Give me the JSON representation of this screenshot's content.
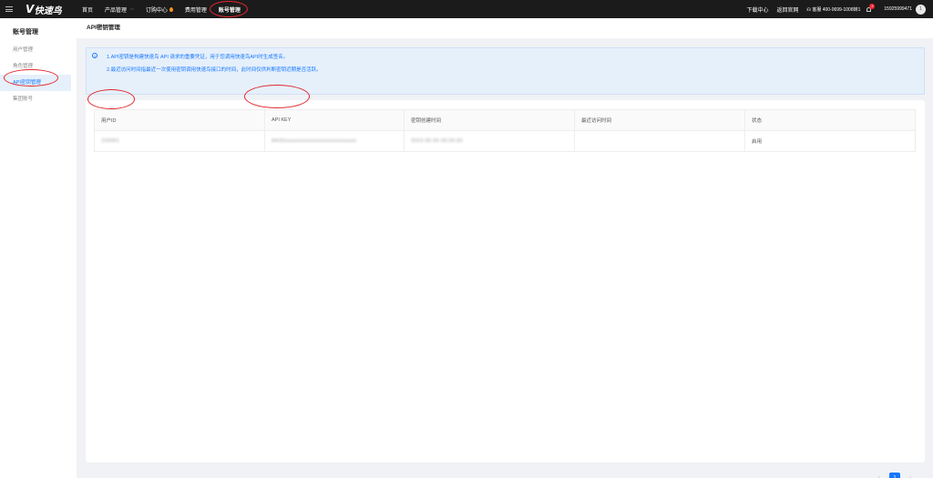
{
  "brand": {
    "mark": "V",
    "name": "快速鸟"
  },
  "nav": {
    "items": [
      {
        "label": "首页"
      },
      {
        "label": "产品管理"
      },
      {
        "label": "订购中心"
      },
      {
        "label": "费用管理"
      },
      {
        "label": "账号管理"
      }
    ]
  },
  "topright": {
    "download": "下载中心",
    "back": "返回官网",
    "phone": "客服 400-0699-1008转1",
    "badge": "3",
    "user_phone": "15925999471",
    "avatar": "1"
  },
  "sidebar": {
    "title": "账号管理",
    "items": [
      {
        "label": "用户管理"
      },
      {
        "label": "角色管理"
      },
      {
        "label": "API密钥管理"
      },
      {
        "label": "集团账号"
      }
    ]
  },
  "page": {
    "title": "API密钥管理"
  },
  "info": {
    "icon": "info-icon",
    "line1": "1.API密钥是构建快速鸟 API 请求的重要凭证，用于您调用快速鸟API时生成签名。",
    "line2": "2.最近访问时间指最近一次使用密钥调用快速鸟接口的时间，此时间仅供判断密钥近期是否活跃。"
  },
  "table": {
    "headers": [
      "用户ID",
      "API KEY",
      "密钥创建时间",
      "最近访问时间",
      "状态"
    ],
    "rows": [
      {
        "user_id": "100001",
        "api_key": "AKIDxxxxxxxxxxxxxxxxxxxxxxxxxx",
        "created": "2023-00-00 00:00:00",
        "last_access": "",
        "status": "启用"
      }
    ]
  },
  "pagination": {
    "current": "1",
    "prev": "‹",
    "next": "›"
  },
  "colors": {
    "accent": "#1677ff",
    "annotation": "#e3262f",
    "topbar": "#1b1b1b"
  }
}
